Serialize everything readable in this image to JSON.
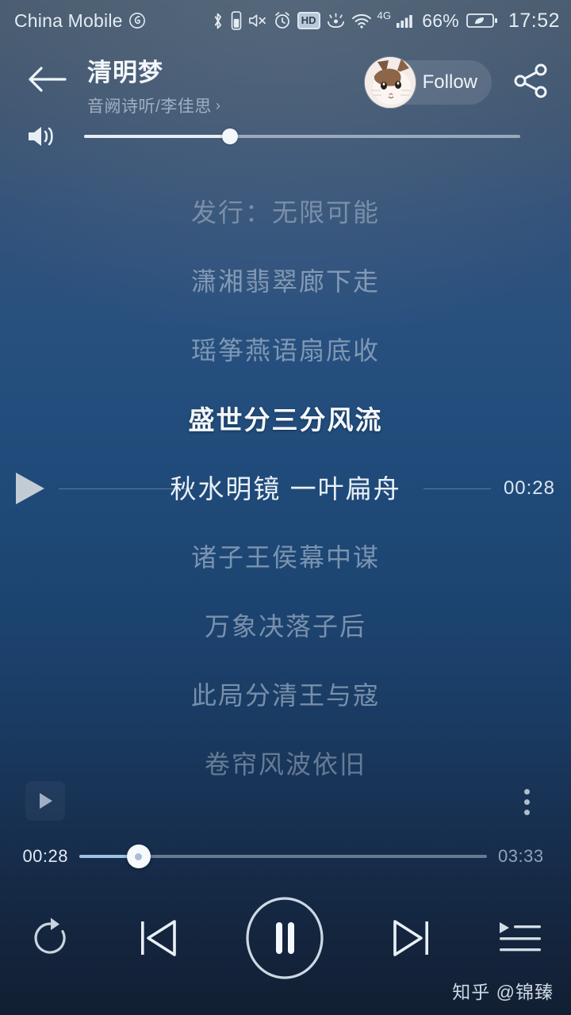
{
  "status_bar": {
    "carrier": "China Mobile",
    "carrier_icon": "netease-music-icon",
    "icons": [
      "bluetooth-icon",
      "bluetooth-device-battery-icon",
      "mute-icon",
      "alarm-icon",
      "hd-icon",
      "eye-comfort-icon",
      "wifi-icon"
    ],
    "hd_label": "HD",
    "network_type": "4G",
    "battery_percent": "66%",
    "battery_icon": "battery-saver-leaf-icon",
    "clock": "17:52"
  },
  "header": {
    "back_icon": "back-arrow-icon",
    "song_title": "清明梦",
    "artist": "音阙诗听/李佳思",
    "artist_chevron": "›",
    "follow_label": "Follow",
    "avatar_icon": "cat-avatar",
    "share_icon": "share-icon"
  },
  "volume": {
    "icon": "volume-icon",
    "level_percent": 33.5
  },
  "lyrics": {
    "lines": [
      {
        "text": "发行：无限可能",
        "state": "dim"
      },
      {
        "text": "潇湘翡翠廊下走",
        "state": "dim"
      },
      {
        "text": "瑶筝燕语扇底收",
        "state": "dim"
      },
      {
        "text": "盛世分三分风流",
        "state": "active"
      },
      {
        "text": "秋水明镜 一叶扁舟",
        "state": "seek"
      },
      {
        "text": "诸子王侯幕中谋",
        "state": "dim"
      },
      {
        "text": "万象决落子后",
        "state": "dim"
      },
      {
        "text": "此局分清王与寇",
        "state": "dim"
      },
      {
        "text": "卷帘风波依旧",
        "state": "dim"
      }
    ],
    "seek_time": "00:28",
    "seek_play_icon": "play-triangle-icon"
  },
  "mini_row": {
    "play_icon": "play-small-icon",
    "more_icon": "more-vertical-icon"
  },
  "progress": {
    "current_time": "00:28",
    "total_time": "03:33",
    "percent": 14.5
  },
  "controls": {
    "repeat_label": "repeat-icon",
    "previous_label": "previous-track-icon",
    "play_pause_label": "pause-icon",
    "next_label": "next-track-icon",
    "playlist_label": "playlist-queue-icon"
  },
  "watermark": {
    "text": "知乎 @锦臻"
  },
  "colors": {
    "bg_top": "#47596c",
    "bg_mid": "#204b7a",
    "bg_bottom": "#121f33",
    "accent": "#9fc0e4",
    "text_primary": "#f2f6fa",
    "text_dim": "#9fb0c2"
  }
}
